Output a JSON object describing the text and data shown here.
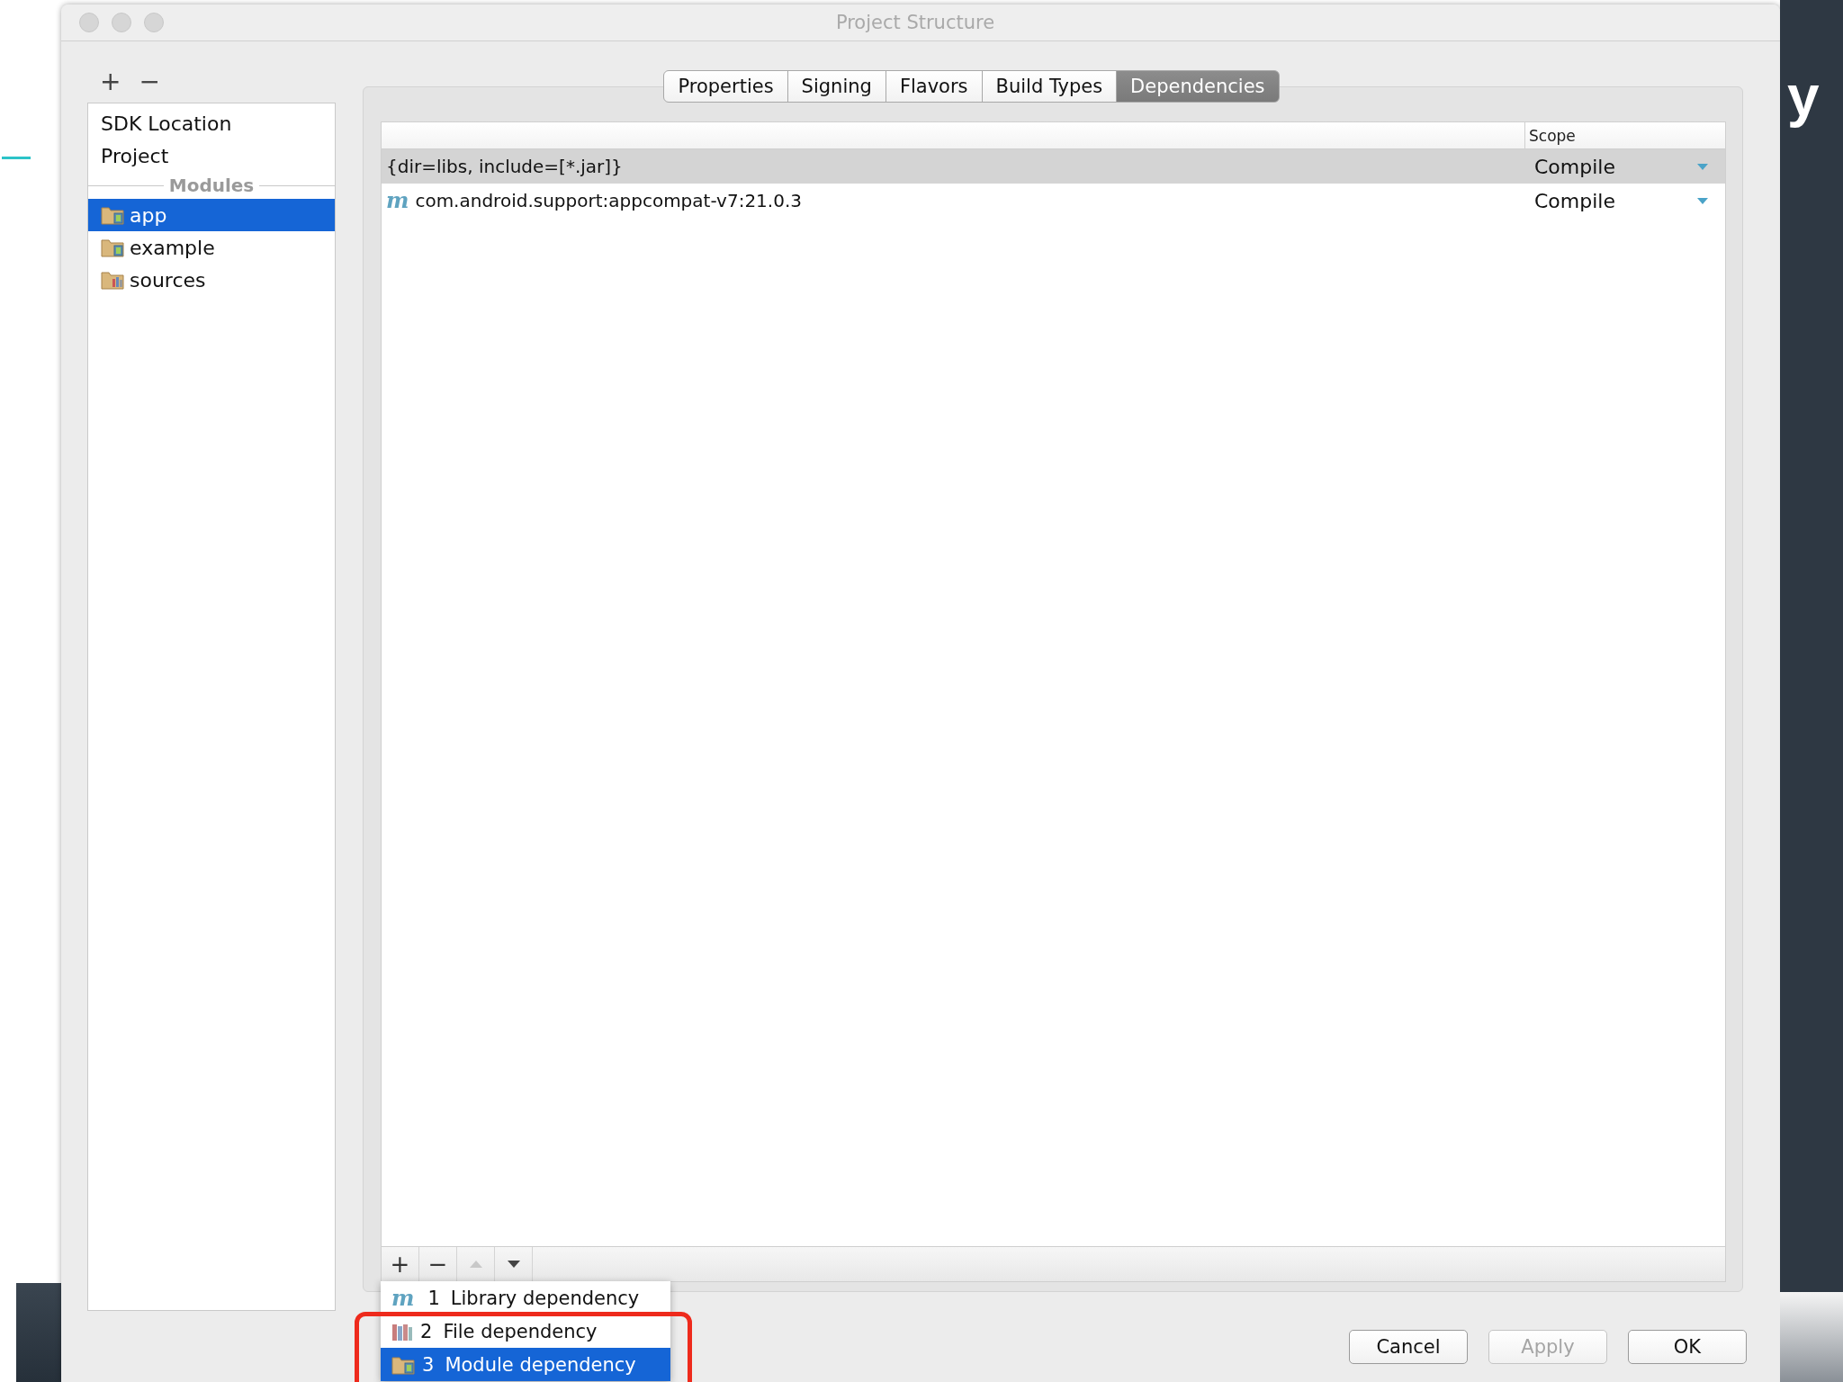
{
  "background": {
    "text": "y"
  },
  "window": {
    "title": "Project Structure"
  },
  "sidebar": {
    "toolbar": [
      "+",
      "−"
    ],
    "items": [
      {
        "label": "SDK Location",
        "kind": "plain",
        "selected": false
      },
      {
        "label": "Project",
        "kind": "plain",
        "selected": false
      },
      {
        "label": "Modules",
        "kind": "header"
      },
      {
        "label": "app",
        "kind": "module",
        "selected": true
      },
      {
        "label": "example",
        "kind": "module",
        "selected": false
      },
      {
        "label": "sources",
        "kind": "source",
        "selected": false
      }
    ]
  },
  "tabs": [
    {
      "label": "Properties",
      "selected": false
    },
    {
      "label": "Signing",
      "selected": false
    },
    {
      "label": "Flavors",
      "selected": false
    },
    {
      "label": "Build Types",
      "selected": false
    },
    {
      "label": "Dependencies",
      "selected": true
    }
  ],
  "table": {
    "scope_header": "Scope",
    "rows": [
      {
        "kind": "file",
        "name": "{dir=libs, include=[*.jar]}",
        "scope": "Compile",
        "selected": true
      },
      {
        "kind": "library",
        "marker": "m",
        "name": "com.android.support:appcompat-v7:21.0.3",
        "scope": "Compile",
        "selected": false
      }
    ]
  },
  "table_toolbar": [
    {
      "kind": "text",
      "label": "+",
      "disabled": false
    },
    {
      "kind": "text",
      "label": "−",
      "disabled": false
    },
    {
      "kind": "up",
      "disabled": true
    },
    {
      "kind": "down",
      "disabled": false
    }
  ],
  "popup": [
    {
      "kind": "library",
      "marker": "m",
      "number": "1",
      "label": "Library dependency",
      "selected": false
    },
    {
      "kind": "file",
      "number": "2",
      "label": "File dependency",
      "selected": false
    },
    {
      "kind": "module",
      "number": "3",
      "label": "Module dependency",
      "selected": true
    }
  ],
  "buttons": [
    {
      "label": "Cancel",
      "disabled": false
    },
    {
      "label": "Apply",
      "disabled": true
    },
    {
      "label": "OK",
      "disabled": false
    }
  ]
}
